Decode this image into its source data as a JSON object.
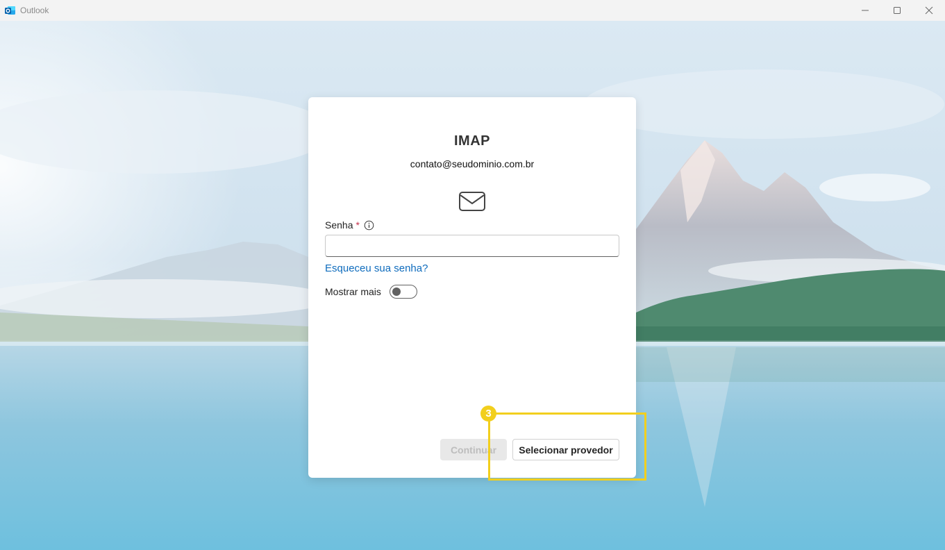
{
  "window": {
    "title": "Outlook",
    "controls": [
      "minimize",
      "maximize",
      "close"
    ]
  },
  "dialog": {
    "title": "IMAP",
    "email": "contato@seudominio.com.br",
    "icon": "mail-icon",
    "password_label": "Senha",
    "required_marker": "*",
    "password_value": "",
    "forgot_link": "Esqueceu sua senha?",
    "show_more_label": "Mostrar mais",
    "show_more_on": false,
    "continue_button": "Continuar",
    "continue_enabled": false,
    "select_provider_button": "Selecionar provedor"
  },
  "annotation": {
    "step_number": "3",
    "color": "#f2cf1d"
  },
  "colors": {
    "link": "#0f6cbd",
    "required": "#c4314b",
    "titlebar": "#f3f3f3"
  }
}
